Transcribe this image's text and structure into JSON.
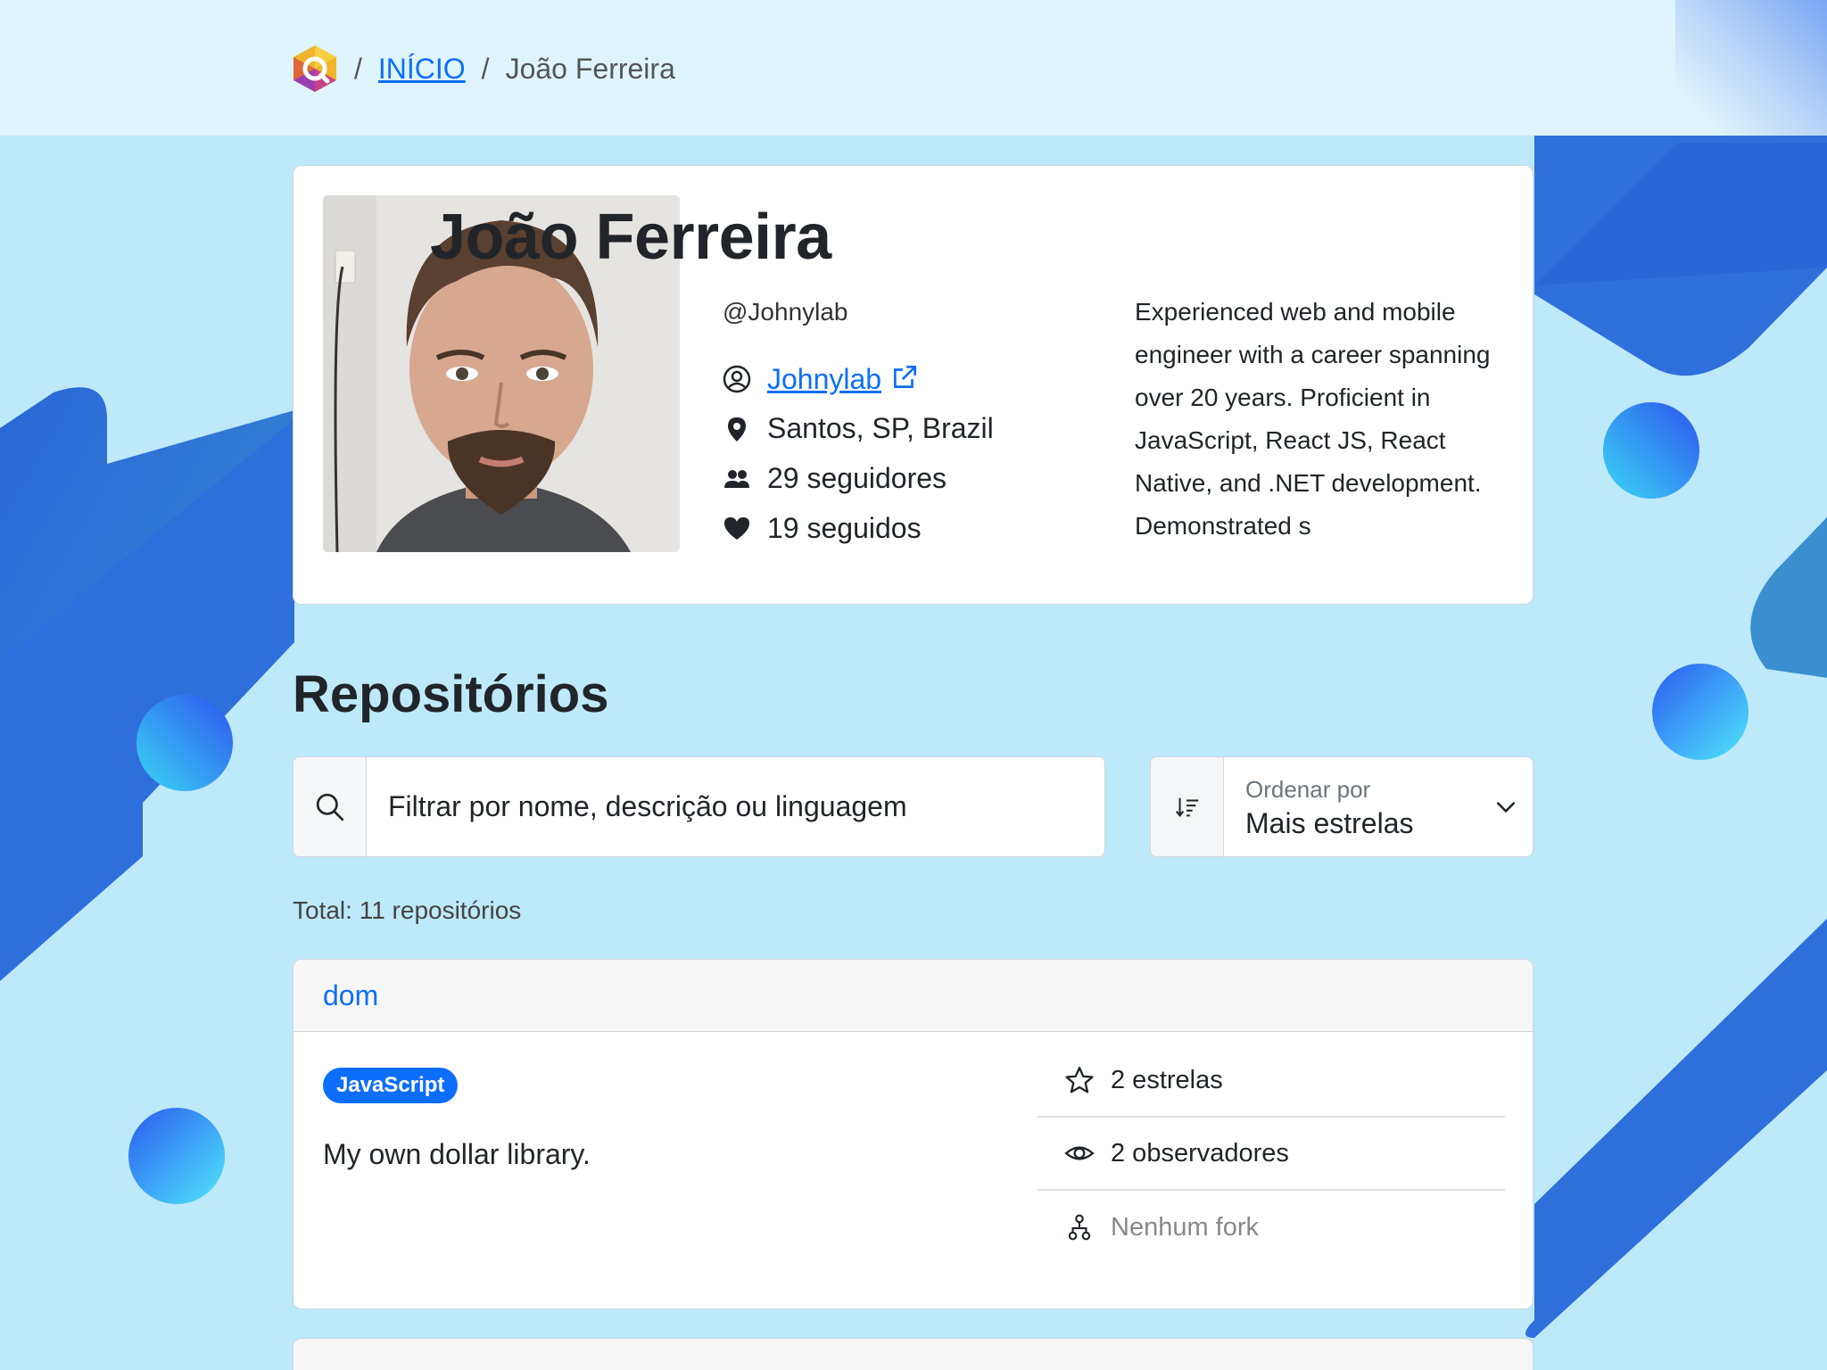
{
  "breadcrumb": {
    "home_label": "INÍCIO",
    "separator": "/",
    "current": "João Ferreira"
  },
  "profile": {
    "name": "João Ferreira",
    "username": "@Johnylab",
    "link_label": "Johnylab",
    "location": "Santos, SP, Brazil",
    "followers": "29 seguidores",
    "following": "19 seguidos",
    "bio": "Experienced web and mobile engineer with a career spanning over 20 years. Proficient in JavaScript, React JS, React Native, and .NET development. Demonstrated s"
  },
  "repositories": {
    "title": "Repositórios",
    "search_placeholder": "Filtrar por nome, descrição ou linguagem",
    "sort_label": "Ordenar por",
    "sort_value": "Mais estrelas",
    "total": "Total: 11 repositórios",
    "items": [
      {
        "name": "dom",
        "language": "JavaScript",
        "description": "My own dollar library.",
        "stars": "2 estrelas",
        "watchers": "2 observadores",
        "forks": "Nenhum fork"
      }
    ]
  },
  "colors": {
    "link": "#0d6efd",
    "background": "#bde9fb",
    "topbar": "#dff5fd",
    "accent_blue": "#2f6fdc"
  },
  "icons": [
    "logo-icon",
    "user-circle-icon",
    "external-link-icon",
    "location-pin-icon",
    "users-icon",
    "heart-icon",
    "search-icon",
    "sort-icon",
    "chevron-down-icon",
    "star-icon",
    "eye-icon",
    "fork-icon"
  ]
}
